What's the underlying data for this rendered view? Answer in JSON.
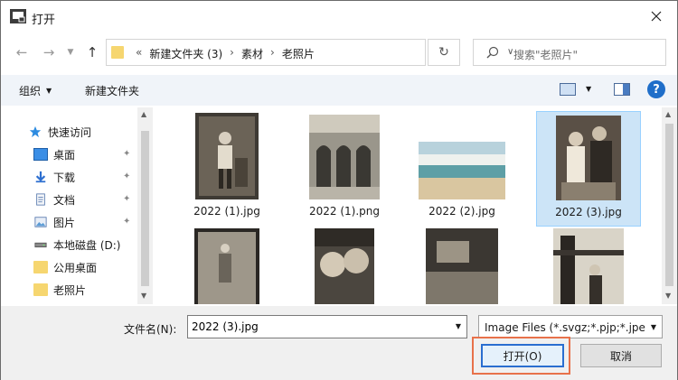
{
  "window": {
    "title": "打开"
  },
  "address": {
    "crumbs": [
      "新建文件夹 (3)",
      "素材",
      "老照片"
    ],
    "overflow": "«",
    "separator": "›"
  },
  "search": {
    "placeholder": "搜索\"老照片\""
  },
  "toolbar": {
    "organize_label": "组织",
    "new_folder_label": "新建文件夹",
    "help_label": "?"
  },
  "nav": {
    "items": [
      {
        "label": "快速访问",
        "icon": "star-icon",
        "pinned": false
      },
      {
        "label": "桌面",
        "icon": "desktop-icon",
        "pinned": true
      },
      {
        "label": "下载",
        "icon": "download-icon",
        "pinned": true
      },
      {
        "label": "文档",
        "icon": "document-icon",
        "pinned": true
      },
      {
        "label": "图片",
        "icon": "pictures-icon",
        "pinned": true
      },
      {
        "label": "本地磁盘 (D:)",
        "icon": "drive-icon",
        "pinned": false
      },
      {
        "label": "公用桌面",
        "icon": "folder-icon",
        "pinned": false
      },
      {
        "label": "老照片",
        "icon": "folder-icon",
        "pinned": false
      }
    ]
  },
  "files": [
    {
      "name": "2022 (1).jpg",
      "selected": false
    },
    {
      "name": "2022 (1).png",
      "selected": false
    },
    {
      "name": "2022 (2).jpg",
      "selected": false
    },
    {
      "name": "2022 (3).jpg",
      "selected": true
    },
    {
      "name": "",
      "selected": false
    },
    {
      "name": "",
      "selected": false
    },
    {
      "name": "",
      "selected": false
    },
    {
      "name": "",
      "selected": false
    }
  ],
  "bottom": {
    "filename_label": "文件名(N):",
    "filename_value": "2022 (3).jpg",
    "filter_value": "Image Files (*.svgz;*.pjp;*.jpeg",
    "open_label": "打开(O)",
    "cancel_label": "取消"
  },
  "colors": {
    "accent": "#2a6ed0",
    "selection": "#cce4f7",
    "highlight_box": "#e8714a"
  }
}
